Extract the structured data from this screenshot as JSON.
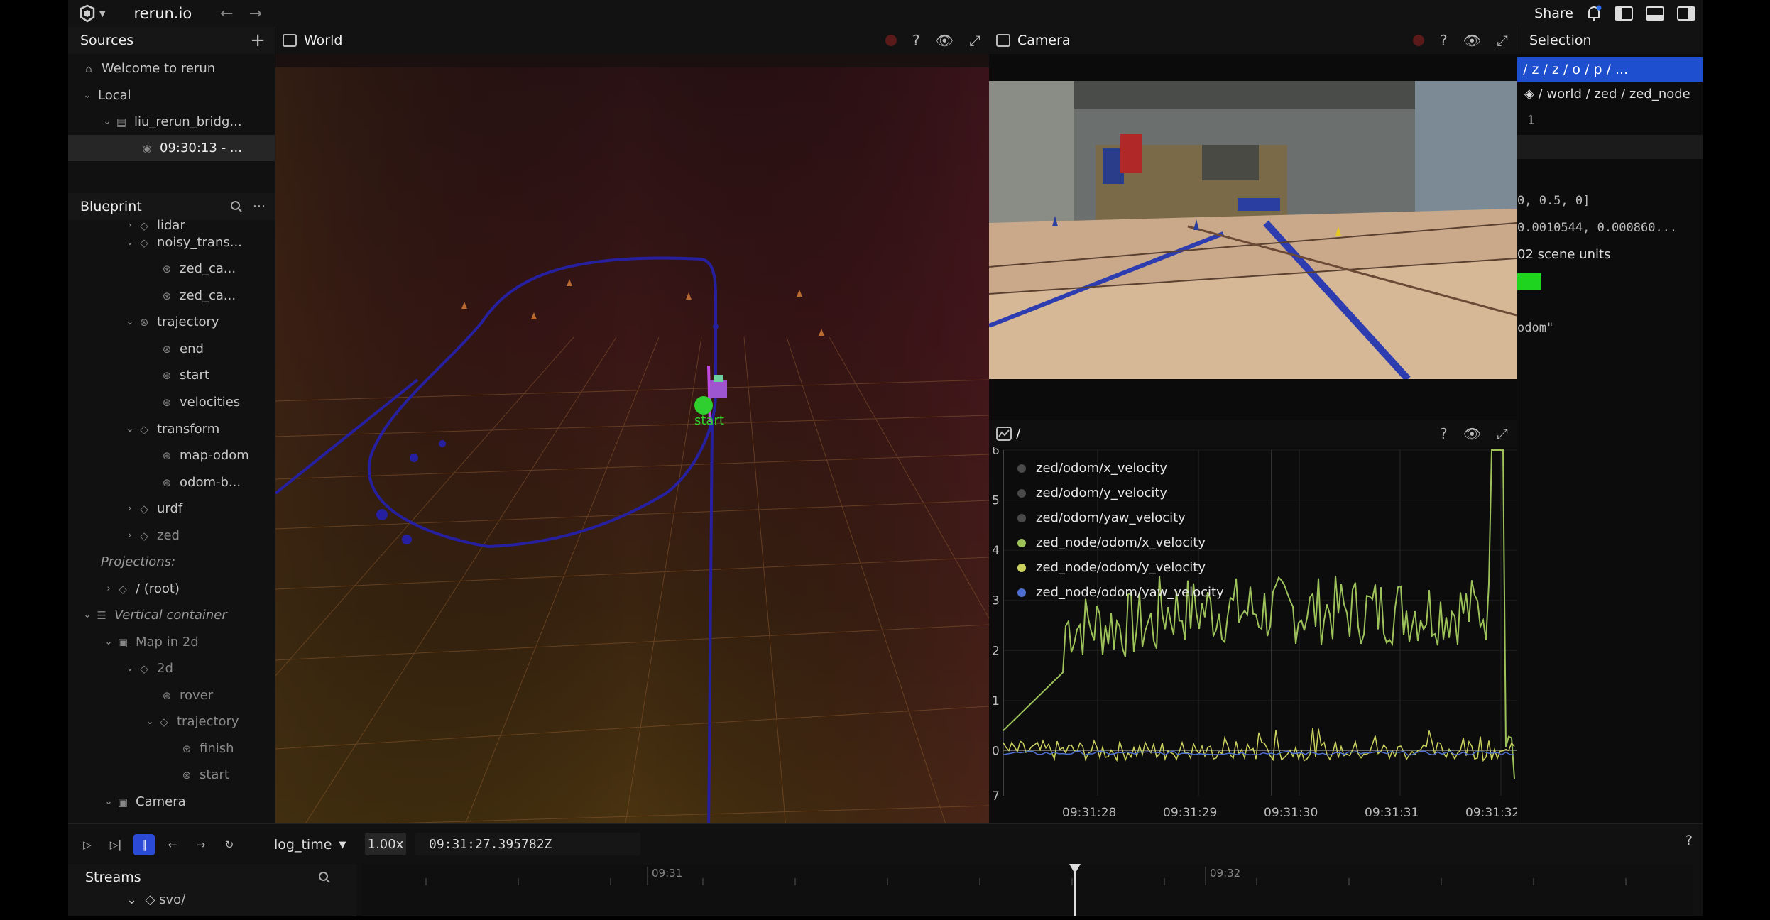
{
  "topbar": {
    "url": "rerun.io",
    "back_arrow": "←",
    "forward_arrow": "→",
    "share_label": "Share"
  },
  "sources": {
    "header": "Sources",
    "add_icon": "+",
    "items": [
      {
        "label": "Welcome to rerun"
      },
      {
        "label": "Local"
      },
      {
        "label": "liu_rerun_bridg..."
      },
      {
        "label": "09:30:13 - ..."
      }
    ]
  },
  "blueprint": {
    "header": "Blueprint",
    "more_icon": "···",
    "items": [
      {
        "label": "lidar"
      },
      {
        "label": "noisy_trans..."
      },
      {
        "label": "zed_ca..."
      },
      {
        "label": "zed_ca..."
      },
      {
        "label": "trajectory"
      },
      {
        "label": "end"
      },
      {
        "label": "start"
      },
      {
        "label": "velocities"
      },
      {
        "label": "transform"
      },
      {
        "label": "map-odom"
      },
      {
        "label": "odom-b..."
      },
      {
        "label": "urdf"
      },
      {
        "label": "zed"
      },
      {
        "label": "Projections:"
      },
      {
        "label": "/ (root)"
      },
      {
        "label": "Vertical container"
      },
      {
        "label": "Map in 2d"
      },
      {
        "label": "2d"
      },
      {
        "label": "rover"
      },
      {
        "label": "trajectory"
      },
      {
        "label": "finish"
      },
      {
        "label": "start"
      },
      {
        "label": "Camera"
      }
    ]
  },
  "world_view": {
    "title": "World",
    "help": "?",
    "start_label": "start"
  },
  "camera_view": {
    "title": "Camera",
    "help": "?"
  },
  "plot_view": {
    "title": "/",
    "help": "?",
    "legend": [
      {
        "label": "zed/odom/x_velocity",
        "color": "#4a4a4a"
      },
      {
        "label": "zed/odom/y_velocity",
        "color": "#4a4a4a"
      },
      {
        "label": "zed/odom/yaw_velocity",
        "color": "#4a4a4a"
      },
      {
        "label": "zed_node/odom/x_velocity",
        "color": "#9dc25a"
      },
      {
        "label": "zed_node/odom/y_velocity",
        "color": "#cbd25e"
      },
      {
        "label": "zed_node/odom/yaw_velocity",
        "color": "#4c6fd0"
      }
    ],
    "y_ticks": [
      "6",
      "5",
      "4",
      "3",
      "2",
      "1",
      "0",
      "7"
    ],
    "x_ticks": [
      "09:31:28",
      "09:31:29",
      "09:31:30",
      "09:31:31",
      "09:31:32"
    ]
  },
  "selection": {
    "header": "Selection",
    "breadcrumb": "/ z / z / o / p / ...",
    "path": "/ world / zed / zed_node",
    "index": "1",
    "value1": "0, 0.5, 0]",
    "value2": "0.0010544, 0.000860...",
    "value3": "02 scene units",
    "value4": "odom\"",
    "swatch_color": "#1ed41e"
  },
  "timeline": {
    "timeline_name": "log_time",
    "speed": "1.00x",
    "current_time": "09:31:27.395782Z",
    "help": "?",
    "streams_label": "Streams",
    "stream_item": "svo/",
    "tick1": "09:31",
    "tick2": "09:32"
  }
}
